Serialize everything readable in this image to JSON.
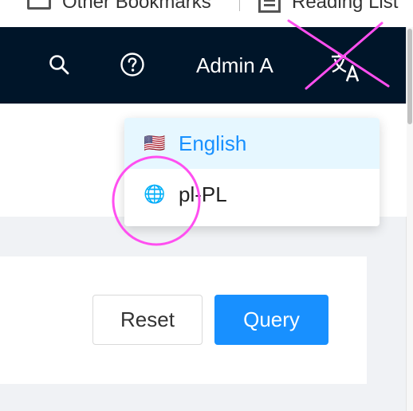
{
  "bookmarks": {
    "other": "Other Bookmarks",
    "reading": "Reading List"
  },
  "header": {
    "user_name": "Admin A",
    "icons": [
      "search-icon",
      "help-icon",
      "translate-icon"
    ]
  },
  "language_menu": {
    "items": [
      {
        "flag": "🇺🇸",
        "label": "English",
        "selected": true
      },
      {
        "flag": "🌐",
        "label": "pl-PL",
        "selected": false
      }
    ]
  },
  "search_form": {
    "reset_label": "Reset",
    "query_label": "Query"
  },
  "colors": {
    "header_bg": "#001529",
    "primary": "#1890ff",
    "selected_bg": "#e6f7ff",
    "annotation": "#ff4ff0"
  }
}
